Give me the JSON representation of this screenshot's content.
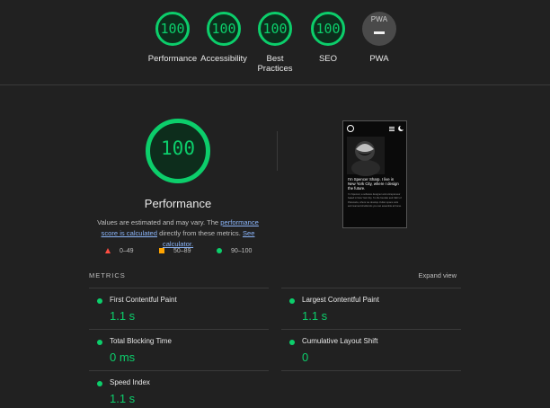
{
  "summary": [
    {
      "score": "100",
      "label": "Performance"
    },
    {
      "score": "100",
      "label": "Accessibility"
    },
    {
      "score": "100",
      "label": "Best Practices",
      "label_l1": "Best",
      "label_l2": "Practices"
    },
    {
      "score": "100",
      "label": "SEO"
    }
  ],
  "pwa": {
    "badge": "PWA",
    "label": "PWA"
  },
  "performance": {
    "score": "100",
    "title": "Performance",
    "desc_1": "Values are estimated and may vary. The ",
    "desc_link_1": "performance score is calculated",
    "desc_2": " directly from these metrics. ",
    "desc_link_2": "See calculator."
  },
  "legend": {
    "fail": "0–49",
    "average": "50–89",
    "pass": "90–100"
  },
  "screenshot": {
    "headline": "I'm Spencer Sharp. I live in New York City, where I design the future.",
    "body": "I'm Spencer, a software designer and entrepreneur based in New York City. I'm the founder and CEO of Planetaria, where we develop civilian space suits and manned shuttle kits you can assemble at home."
  },
  "metrics": {
    "heading": "METRICS",
    "expand": "Expand view",
    "items": [
      {
        "label": "First Contentful Paint",
        "value": "1.1 s"
      },
      {
        "label": "Largest Contentful Paint",
        "value": "1.1 s"
      },
      {
        "label": "Total Blocking Time",
        "value": "0 ms"
      },
      {
        "label": "Cumulative Layout Shift",
        "value": "0"
      },
      {
        "label": "Speed Index",
        "value": "1.1 s"
      }
    ]
  },
  "colors": {
    "pass": "#0cce6b",
    "average": "#ffa400",
    "fail": "#ff4e42",
    "link": "#8ab4f8"
  }
}
